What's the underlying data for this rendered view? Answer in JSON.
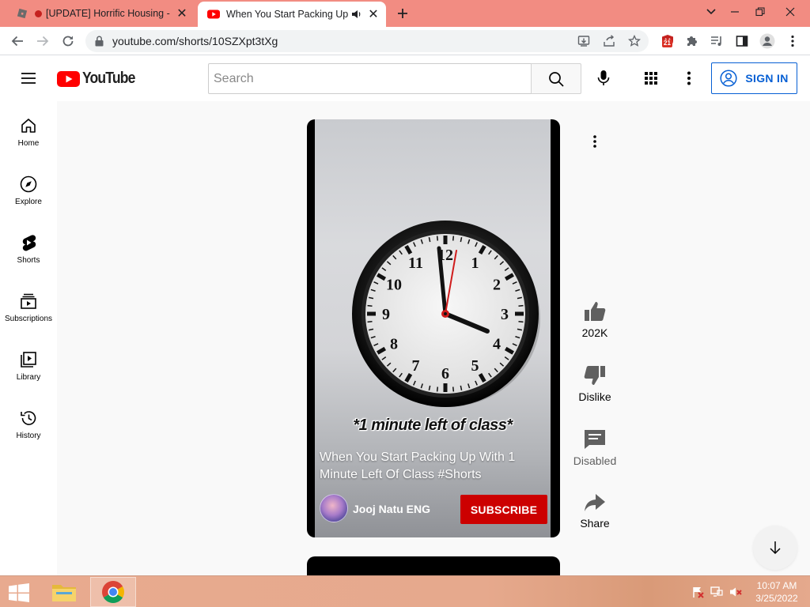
{
  "browser": {
    "tabs": [
      {
        "title": "[UPDATE] Horrific Housing - R",
        "recording": true
      },
      {
        "title": "When You Start Packing Up W",
        "audio": true
      }
    ],
    "url": "youtube.com/shorts/10SZXpt3tXg",
    "extension_badge": "21"
  },
  "youtube": {
    "logo_text": "YouTube",
    "search_placeholder": "Search",
    "sign_in": "SIGN IN"
  },
  "guide": {
    "items": [
      {
        "label": "Home",
        "icon": "home-icon"
      },
      {
        "label": "Explore",
        "icon": "compass-icon"
      },
      {
        "label": "Shorts",
        "icon": "shorts-icon"
      },
      {
        "label": "Subscriptions",
        "icon": "subscriptions-icon"
      },
      {
        "label": "Library",
        "icon": "library-icon"
      },
      {
        "label": "History",
        "icon": "history-icon"
      }
    ]
  },
  "short": {
    "caption": "*1 minute left of class*",
    "title": "When You Start Packing Up With 1 Minute Left Of Class #Shorts",
    "channel": "Jooj Natu ENG",
    "subscribe": "SUBSCRIBE",
    "clock_numbers": [
      "12",
      "1",
      "2",
      "3",
      "4",
      "5",
      "6",
      "7",
      "8",
      "9",
      "10",
      "11"
    ]
  },
  "actions": {
    "like_count": "202K",
    "dislike": "Dislike",
    "comments": "Disabled",
    "share": "Share"
  },
  "taskbar": {
    "time": "10:07 AM",
    "date": "3/25/2022"
  },
  "colors": {
    "youtube_red": "#ff0000",
    "subscribe_red": "#cc0000",
    "signin_blue": "#065fd4",
    "tabstrip": "#f28c82"
  }
}
